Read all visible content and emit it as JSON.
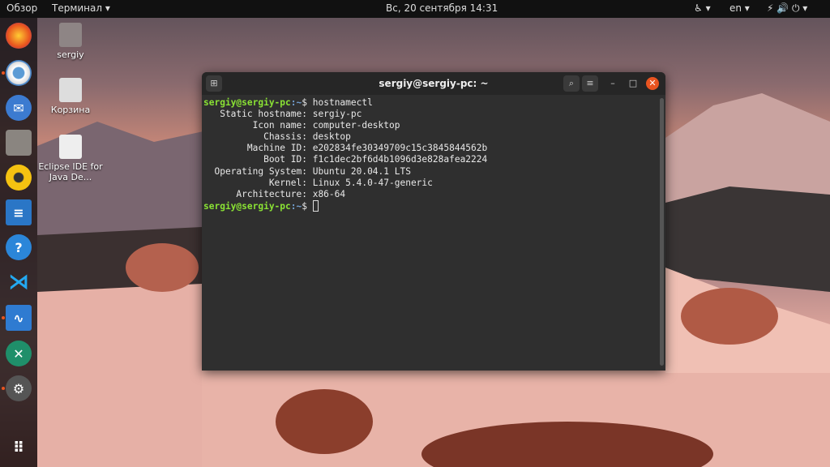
{
  "topbar": {
    "overview": "Обзор",
    "app_menu": "Терминал ▾",
    "clock": "Вс, 20 сентября  14:31",
    "accessibility": "♿ ▾",
    "lang": "en ▾",
    "system": "⚡ 🔊 ⏻ ▾"
  },
  "dock": {
    "items": [
      "firefox-icon",
      "chromium-icon",
      "thunderbird-icon",
      "files-icon",
      "rhythmbox-icon",
      "libreoffice-writer-icon",
      "help-icon",
      "vscode-icon",
      "system-monitor-icon",
      "synaptic-icon",
      "settings-icon",
      "show-apps-icon"
    ]
  },
  "desktop": {
    "icons": [
      {
        "label": "sergiy"
      },
      {
        "label": "Корзина"
      },
      {
        "label": "Eclipse IDE for Java De..."
      }
    ]
  },
  "terminal": {
    "title": "sergiy@sergiy-pc: ~",
    "prompt_user": "sergiy@sergiy-pc",
    "prompt_path": ":~",
    "prompt_sym": "$ ",
    "command": "hostnamectl",
    "output": [
      "   Static hostname: sergiy-pc",
      "         Icon name: computer-desktop",
      "           Chassis: desktop",
      "        Machine ID: e202834fe30349709c15c3845844562b",
      "           Boot ID: f1c1dec2bf6d4b1096d3e828afea2224",
      "  Operating System: Ubuntu 20.04.1 LTS",
      "            Kernel: Linux 5.4.0-47-generic",
      "      Architecture: x86-64"
    ]
  }
}
